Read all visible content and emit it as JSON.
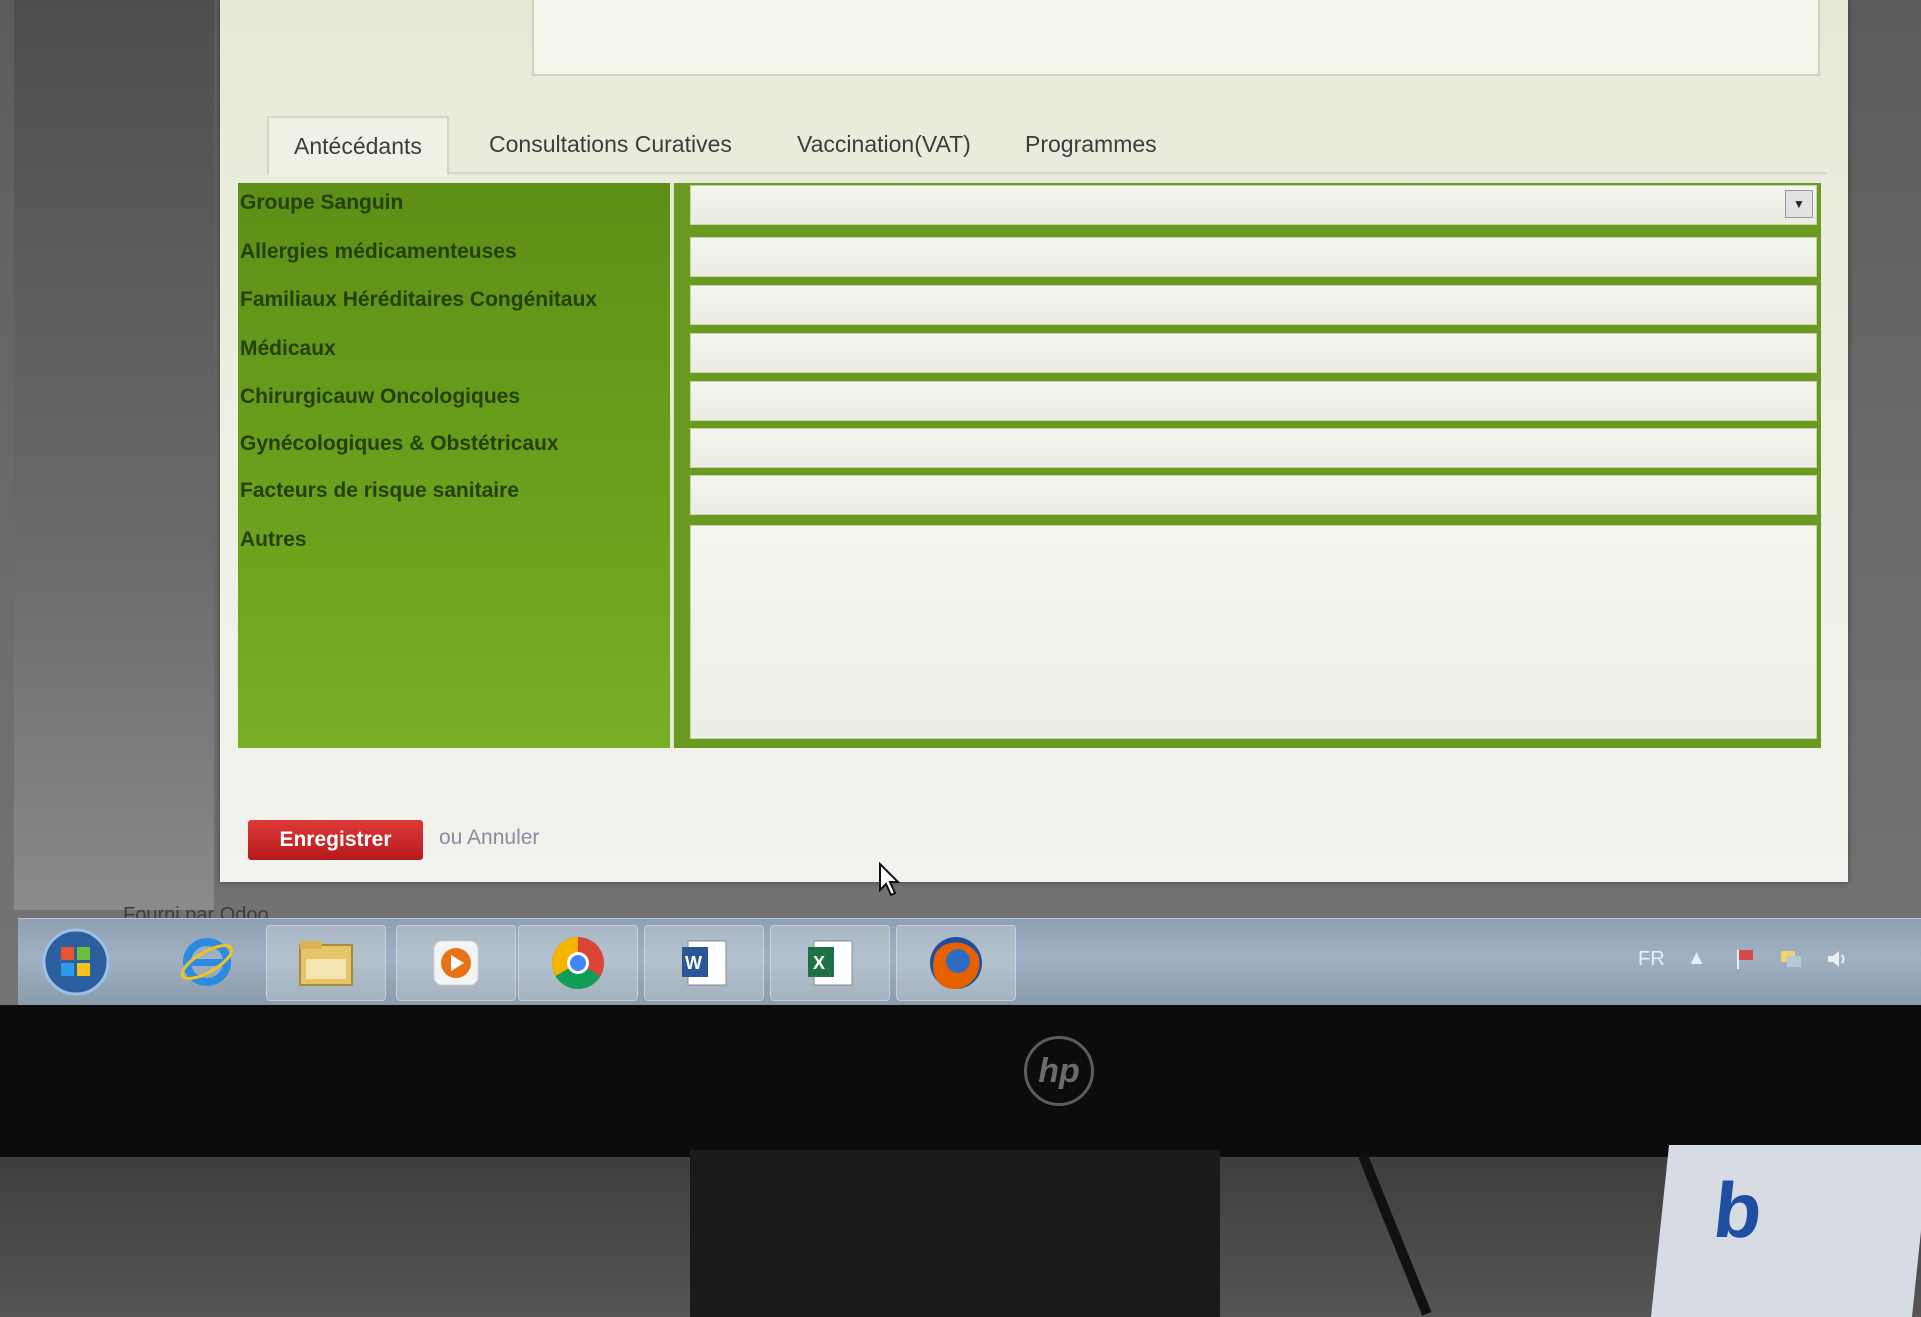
{
  "background": {
    "menu_items": [
      "",
      "",
      "",
      ""
    ],
    "powered_by": "Fourni par Odoo"
  },
  "tabs": [
    {
      "label": "Antécédants",
      "active": true
    },
    {
      "label": "Consultations Curatives",
      "active": false
    },
    {
      "label": "Vaccination(VAT)",
      "active": false
    },
    {
      "label": "Programmes",
      "active": false
    }
  ],
  "form": {
    "fields": [
      {
        "label": "Groupe Sanguin",
        "value": "",
        "type": "select"
      },
      {
        "label": "Allergies médicamenteuses",
        "value": ""
      },
      {
        "label": "Familiaux Héréditaires Congénitaux",
        "value": ""
      },
      {
        "label": "Médicaux",
        "value": ""
      },
      {
        "label": "Chirurgicauw Oncologiques",
        "value": ""
      },
      {
        "label": "Gynécologiques & Obstétricaux",
        "value": ""
      },
      {
        "label": "Facteurs de risque sanitaire",
        "value": ""
      },
      {
        "label": "Autres",
        "value": "",
        "type": "textarea"
      }
    ],
    "accent_color": "#6a9a20"
  },
  "actions": {
    "save_label": "Enregistrer",
    "or_text": "ou ",
    "cancel_label": "Annuler",
    "save_color": "#c8202a"
  },
  "taskbar": {
    "apps": [
      "start-orb-icon",
      "internet-explorer-icon",
      "file-explorer-icon",
      "media-player-icon",
      "chrome-icon",
      "word-icon",
      "excel-icon",
      "firefox-icon"
    ],
    "language": "FR"
  },
  "monitor": {
    "brand": "hp",
    "box_logo": "b"
  }
}
